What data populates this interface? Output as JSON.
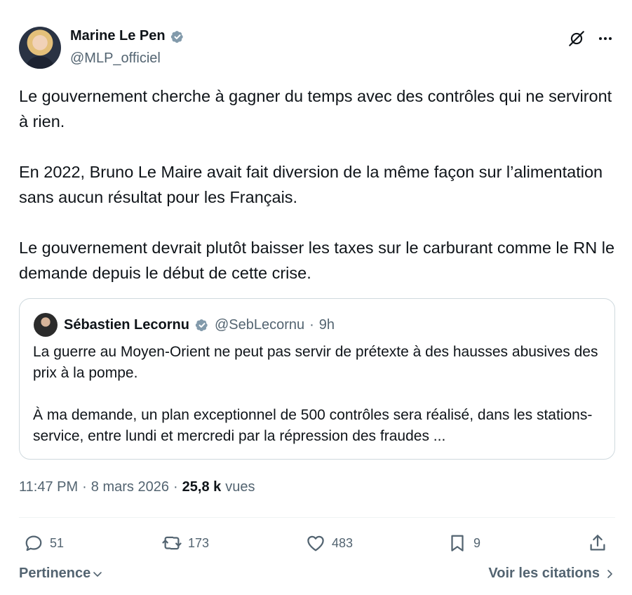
{
  "tweet": {
    "author": {
      "display_name": "Marine Le Pen",
      "handle": "@MLP_officiel",
      "verified": true
    },
    "paragraphs": [
      "Le gouvernement cherche à gagner du temps avec des contrôles qui ne serviront à rien.",
      "En 2022, Bruno Le Maire avait fait diversion de la même façon sur l’alimentation sans aucun résultat pour les Français.",
      "Le gouvernement devrait plutôt baisser les taxes sur le carburant comme le RN le demande depuis le début de cette crise."
    ],
    "quoted": {
      "display_name": "Sébastien Lecornu",
      "handle": "@SebLecornu",
      "separator": "·",
      "age": "9h",
      "verified": true,
      "paragraphs": [
        "La guerre au Moyen-Orient ne peut pas servir de prétexte à des hausses abusives des prix à la pompe.",
        "À ma demande, un plan exceptionnel de 500 contrôles sera réalisé, dans les stations-service, entre lundi et mercredi par la répression des fraudes ..."
      ]
    },
    "meta": {
      "time": "11:47 PM",
      "separator": "·",
      "date": "8 mars 2026",
      "views_count": "25,8 k",
      "views_label": "vues"
    },
    "actions": {
      "replies": "51",
      "reposts": "173",
      "likes": "483",
      "bookmarks": "9"
    },
    "footer": {
      "sort_label": "Pertinence",
      "quotes_link": "Voir les citations"
    },
    "icons": {
      "verified": "verified-badge-icon",
      "grok": "grok-icon",
      "more": "more-icon",
      "reply": "reply-icon",
      "repost": "repost-icon",
      "like": "heart-icon",
      "bookmark": "bookmark-icon",
      "share": "share-icon"
    },
    "colors": {
      "text_primary": "#0f1419",
      "text_secondary": "#536471",
      "border": "#cfd9de",
      "verified_badge": "#829aab"
    }
  }
}
